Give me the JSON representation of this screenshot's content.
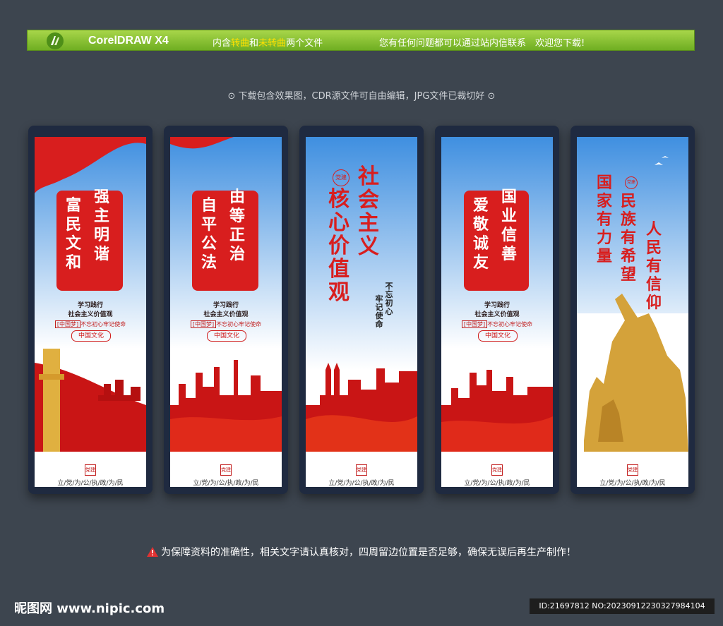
{
  "header": {
    "product": "CorelDRAW X4",
    "contains_pre": "内含",
    "hl1": "转曲",
    "and": "和",
    "hl2": "未转曲",
    "contains_post": "两个文件",
    "contact": "您有任何问题都可以通过站内信联系　欢迎您下载!"
  },
  "subtitle": "⊙ 下载包含效果图，CDR源文件可自由编辑，JPG文件已裁切好 ⊙",
  "common": {
    "caption1": "学习践行",
    "caption2": "社会主义价值观",
    "dream_tag": "[中国梦]",
    "dream_text": "不忘初心牢记使命",
    "culture": "中国文化",
    "footer": "立/党/为/公/执/政/为/民",
    "seal": "党建"
  },
  "panels": [
    {
      "col1": "富民文和",
      "col2": "强主明谐"
    },
    {
      "col1": "自平公法",
      "col2": "由等正治"
    },
    {
      "col1": "核心价值观",
      "col2": "社会主义",
      "badge": "党建",
      "small1": "不忘初心",
      "small2": "牢记使命"
    },
    {
      "col1": "爱敬诚友",
      "col2": "国业信善"
    },
    {
      "col1": "国家有力量",
      "col2": "民族有希望",
      "col3": "人民有信仰",
      "badge": "党建"
    }
  ],
  "notice": "为保障资料的准确性，相关文字请认真核对，四周留边位置是否足够，确保无误后再生产制作！",
  "brand": "昵图网 www.nipic.com",
  "id_text": "ID:21697812 NO:20230912230327984104",
  "colors": {
    "accent": "#d81e1e",
    "bar": "#8cc63f",
    "bg": "#3d454f"
  }
}
